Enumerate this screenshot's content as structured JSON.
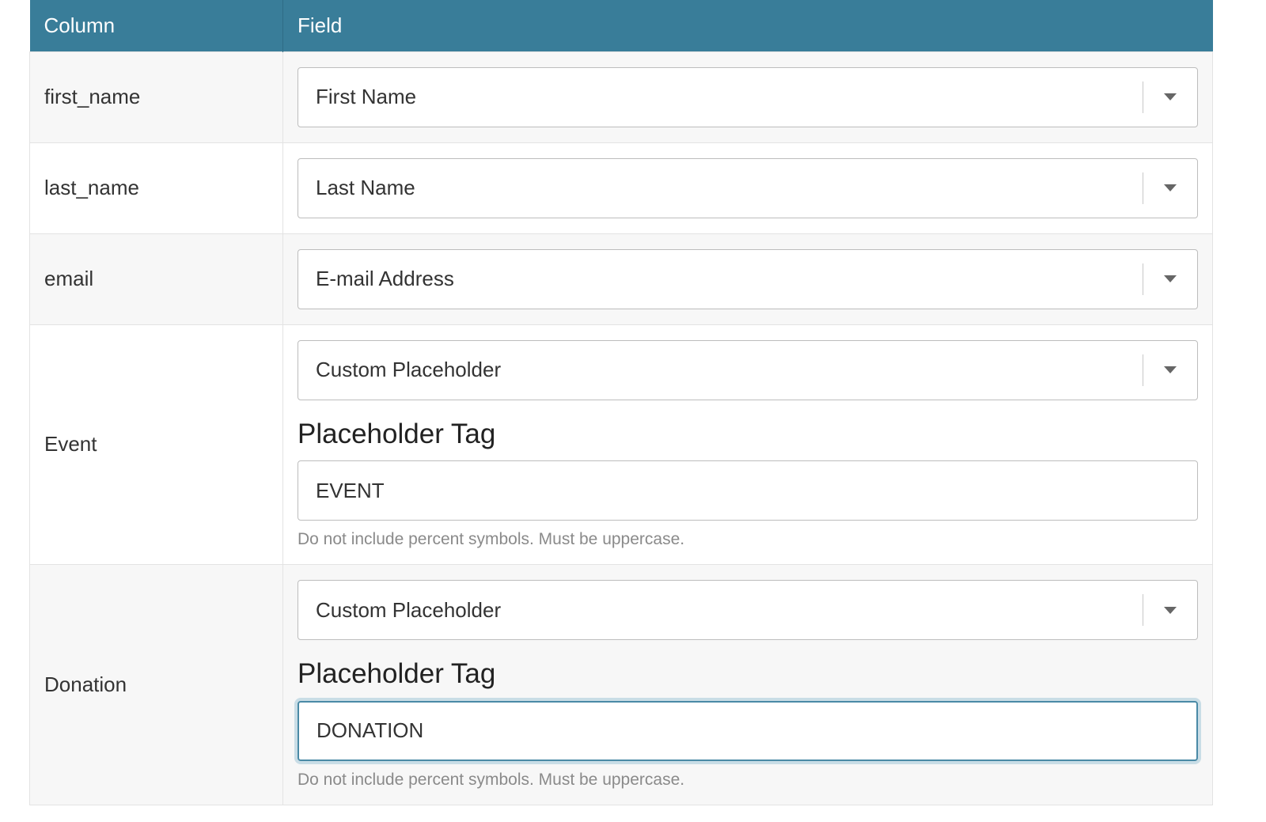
{
  "table": {
    "headers": {
      "column": "Column",
      "field": "Field"
    },
    "rows": [
      {
        "column": "first_name",
        "field": "First Name"
      },
      {
        "column": "last_name",
        "field": "Last Name"
      },
      {
        "column": "email",
        "field": "E-mail Address"
      },
      {
        "column": "Event",
        "field": "Custom Placeholder",
        "placeholder_label": "Placeholder Tag",
        "placeholder_value": "EVENT",
        "help": "Do not include percent symbols. Must be uppercase."
      },
      {
        "column": "Donation",
        "field": "Custom Placeholder",
        "placeholder_label": "Placeholder Tag",
        "placeholder_value": "DONATION",
        "help": "Do not include percent symbols. Must be uppercase."
      }
    ]
  },
  "icons": {
    "dropdown_caret": "chevron-down-icon"
  },
  "colors": {
    "header_bg": "#397d99",
    "header_text": "#ffffff",
    "focus_border": "#4a8aa6"
  }
}
